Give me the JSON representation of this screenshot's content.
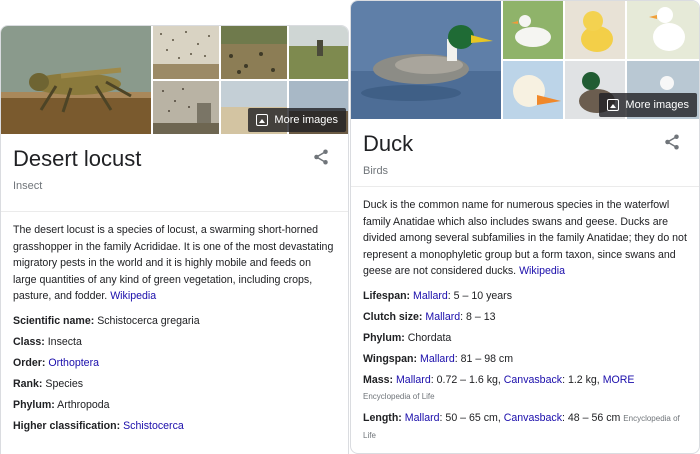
{
  "locust": {
    "more_images": "More images",
    "title": "Desert locust",
    "subtitle": "Insect",
    "description": "The desert locust is a species of locust, a swarming short-horned grasshopper in the family Acrididae. It is one of the most devastating migratory pests in the world and it is highly mobile and feeds on large quantities of any kind of green vegetation, including crops, pasture, and fodder. ",
    "description_link": "Wikipedia",
    "facts": [
      {
        "label": "Scientific name:",
        "value": " Schistocerca gregaria"
      },
      {
        "label": "Class:",
        "value": " Insecta"
      },
      {
        "label": "Order:",
        "link": "Orthoptera"
      },
      {
        "label": "Rank:",
        "value": " Species"
      },
      {
        "label": "Phylum:",
        "value": " Arthropoda"
      },
      {
        "label": "Higher classification:",
        "link": "Schistocerca"
      }
    ]
  },
  "duck": {
    "more_images": "More images",
    "title": "Duck",
    "subtitle": "Birds",
    "description": "Duck is the common name for numerous species in the waterfowl family Anatidae which also includes swans and geese. Ducks are divided among several subfamilies in the family Anatidae; they do not represent a monophyletic group but a form taxon, since swans and geese are not considered ducks. ",
    "description_link": "Wikipedia",
    "lifespan": {
      "label": "Lifespan:",
      "link": "Mallard",
      "value": ": 5 – 10 years"
    },
    "clutch": {
      "label": "Clutch size:",
      "link": "Mallard",
      "value": ": 8 – 13"
    },
    "phylum": {
      "label": "Phylum:",
      "value": " Chordata"
    },
    "wingspan": {
      "label": "Wingspan:",
      "link": "Mallard",
      "value": ": 81 – 98 cm"
    },
    "mass": {
      "label": "Mass:",
      "link1": "Mallard",
      "value1": ": 0.72 – 1.6 kg, ",
      "link2": "Canvasback",
      "value2": ": 1.2 kg, ",
      "link3": "MORE",
      "source": "Encyclopedia of Life"
    },
    "length": {
      "label": "Length:",
      "link1": "Mallard",
      "value1": ": 50 – 65 cm, ",
      "link2": "Canvasback",
      "value2": ": 48 – 56 cm ",
      "source": "Encyclopedia of Life"
    }
  },
  "colors": {
    "link": "#1a0dab",
    "text": "#202124",
    "muted": "#70757a",
    "border": "#dadce0"
  },
  "icons": {
    "share": "share-icon",
    "images": "image-icon"
  }
}
